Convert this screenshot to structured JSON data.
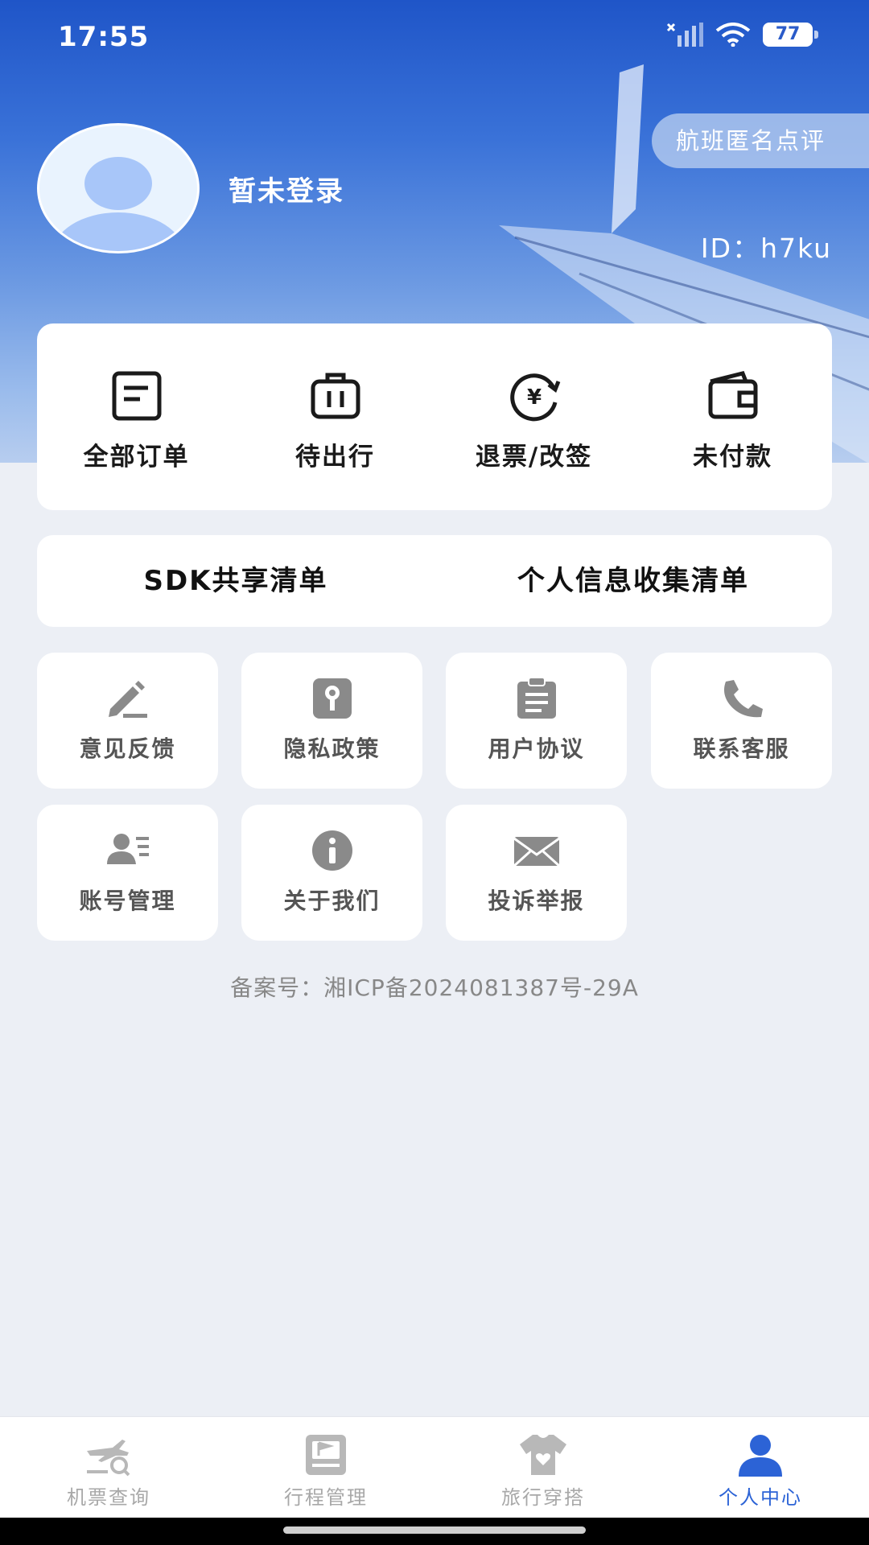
{
  "status_bar": {
    "time": "17:55",
    "battery": "77"
  },
  "profile": {
    "login_status": "暂未登录",
    "review_button": "航班匿名点评",
    "user_id": "ID：h7ku"
  },
  "orders": [
    {
      "label": "全部订单",
      "icon": "order-list-icon"
    },
    {
      "label": "待出行",
      "icon": "luggage-icon"
    },
    {
      "label": "退票/改签",
      "icon": "refund-yen-icon"
    },
    {
      "label": "未付款",
      "icon": "wallet-icon"
    }
  ],
  "lists": {
    "sdk": "SDK共享清单",
    "personal_info": "个人信息收集清单"
  },
  "services": [
    {
      "label": "意见反馈",
      "icon": "pencil-icon"
    },
    {
      "label": "隐私政策",
      "icon": "keyhole-icon"
    },
    {
      "label": "用户协议",
      "icon": "clipboard-icon"
    },
    {
      "label": "联系客服",
      "icon": "phone-icon"
    },
    {
      "label": "账号管理",
      "icon": "account-card-icon"
    },
    {
      "label": "关于我们",
      "icon": "info-icon"
    },
    {
      "label": "投诉举报",
      "icon": "mail-icon"
    }
  ],
  "icp": "备案号：湘ICP备2024081387号-29A",
  "tabs": [
    {
      "label": "机票查询",
      "icon": "plane-search-icon",
      "active": false
    },
    {
      "label": "行程管理",
      "icon": "itinerary-icon",
      "active": false
    },
    {
      "label": "旅行穿搭",
      "icon": "tshirt-heart-icon",
      "active": false
    },
    {
      "label": "个人中心",
      "icon": "user-icon",
      "active": true
    }
  ],
  "colors": {
    "accent": "#2c63d6",
    "hero_top": "#1f55c8",
    "background": "#eceff5",
    "icon_gray": "#8a8a8a",
    "tab_inactive": "#a8a8a8"
  }
}
